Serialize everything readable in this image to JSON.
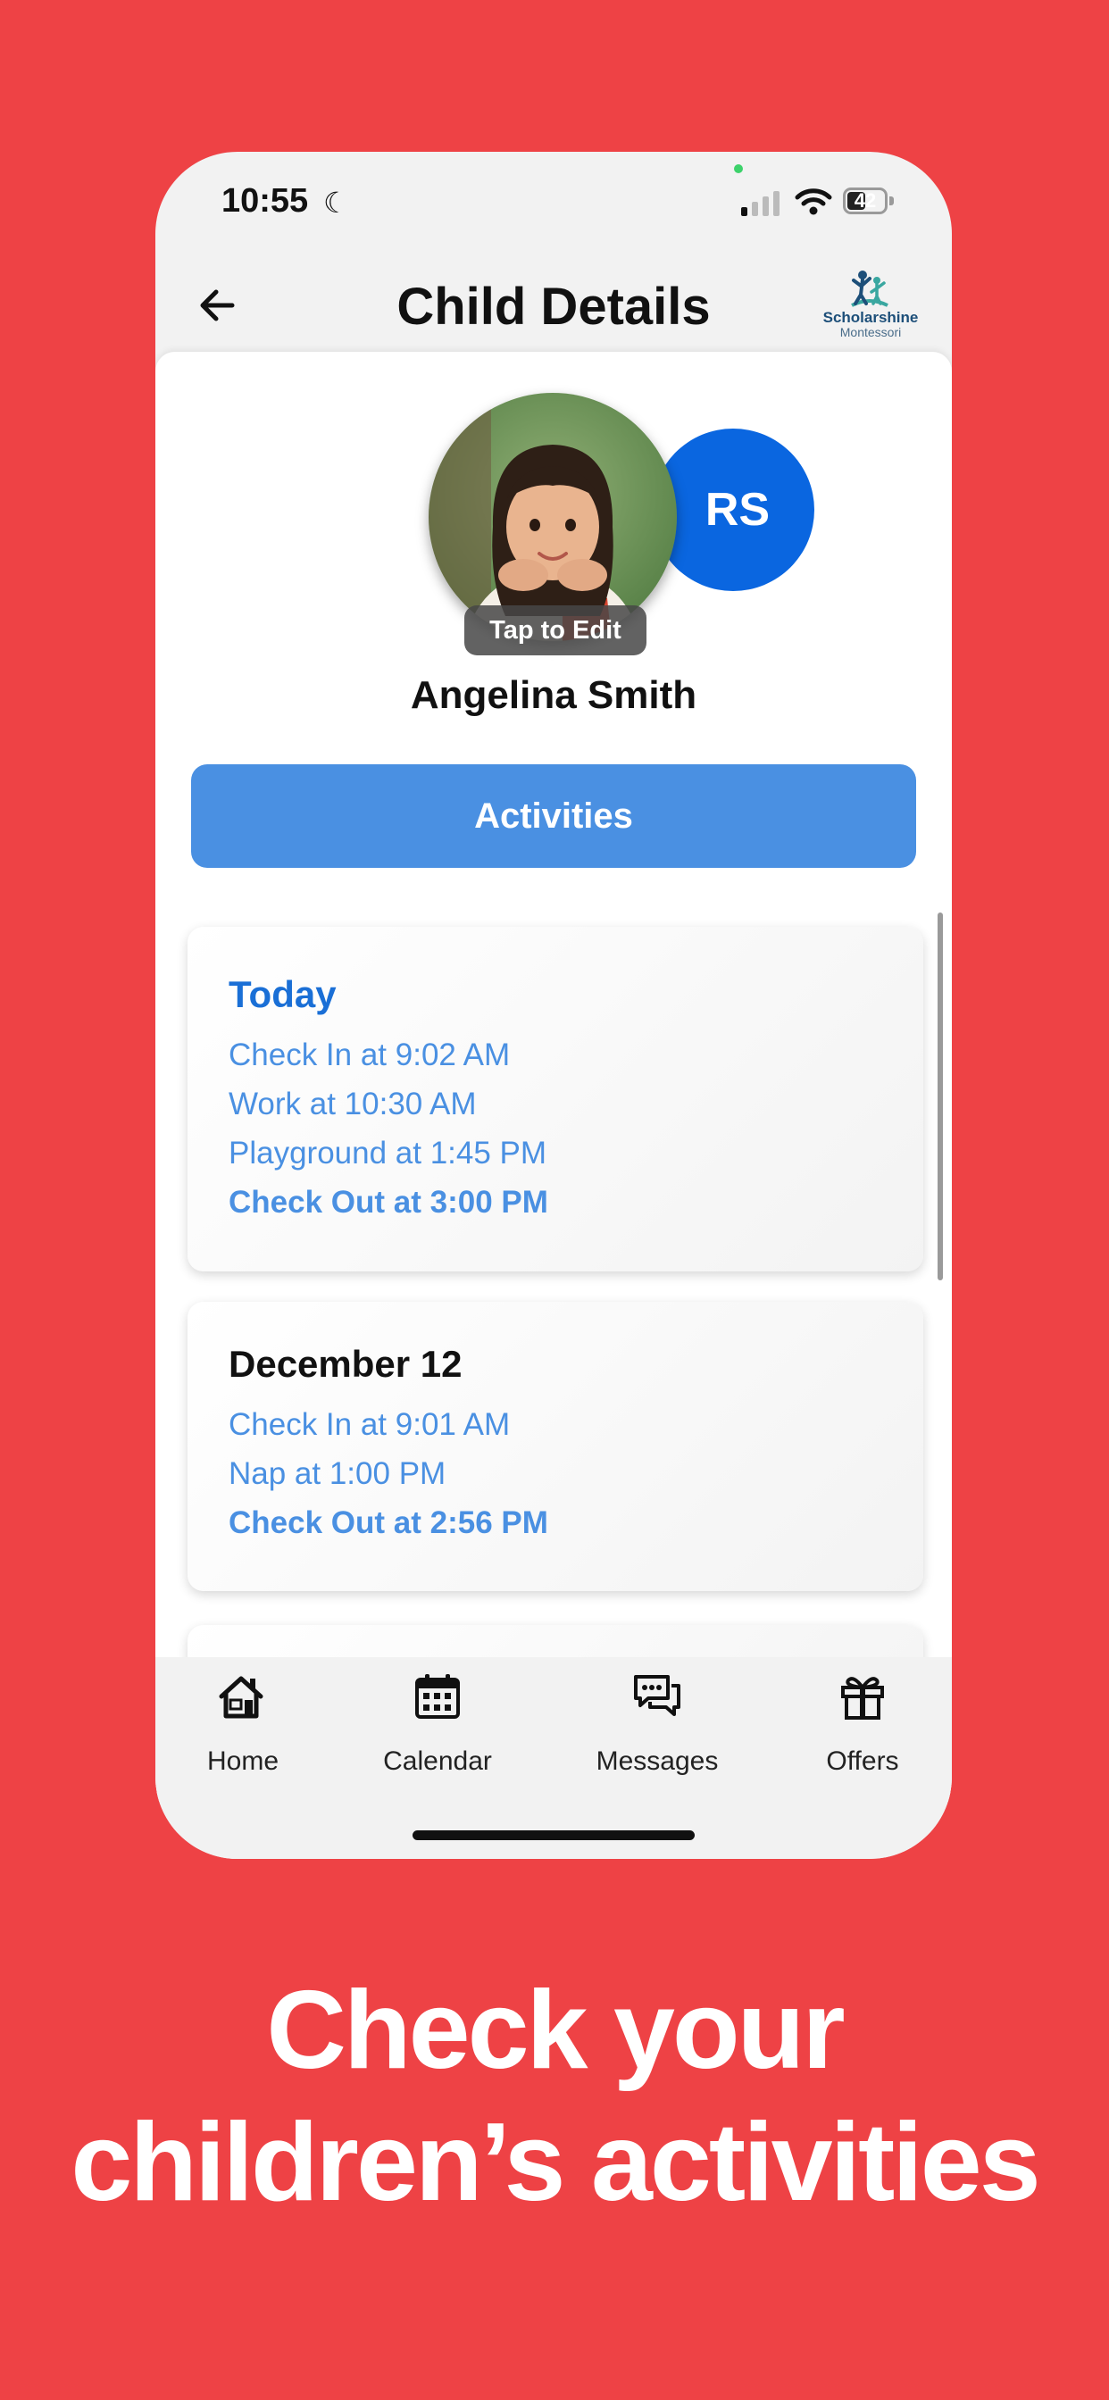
{
  "status_bar": {
    "time": "10:55",
    "battery": "42"
  },
  "nav": {
    "title": "Child Details",
    "logo_name": "Scholarshine",
    "logo_sub": "Montessori"
  },
  "profile": {
    "initials": "RS",
    "tap_to_edit": "Tap to Edit",
    "child_name": "Angelina Smith"
  },
  "activities_button": "Activities",
  "activity_cards": [
    {
      "title": "Today",
      "items": [
        "Check In at 9:02 AM",
        "Work at 10:30 AM",
        "Playground at 1:45 PM",
        "Check Out at 3:00 PM"
      ]
    },
    {
      "title": "December 12",
      "items": [
        "Check In at 9:01 AM",
        "Nap at 1:00 PM",
        "Check Out at 2:56 PM"
      ]
    }
  ],
  "tabs": [
    {
      "label": "Home",
      "icon": "home-icon"
    },
    {
      "label": "Calendar",
      "icon": "calendar-icon"
    },
    {
      "label": "Messages",
      "icon": "messages-icon"
    },
    {
      "label": "Offers",
      "icon": "gift-icon"
    }
  ],
  "headline": {
    "line1": "Check your",
    "line2": "children’s activities"
  },
  "colors": {
    "background": "#EE4245",
    "accent": "#4A90E2",
    "avatar": "#0A66E0",
    "today_title": "#1A6FD6"
  }
}
